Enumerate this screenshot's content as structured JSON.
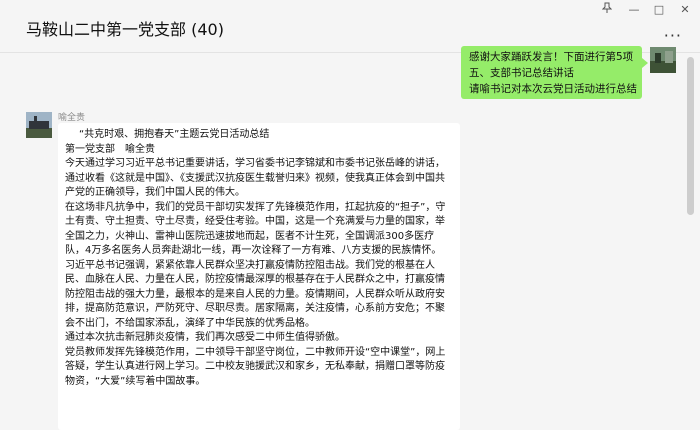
{
  "window": {
    "title": "马鞍山二中第一党支部 (40)",
    "pin_icon": "pin-icon",
    "minimize_label": "—",
    "maximize_label": "□",
    "close_label": "✕",
    "more_label": "···"
  },
  "messages": [
    {
      "side": "right",
      "lines": [
        "感谢大家踊跃发言！下面进行第5项",
        "五、支部书记总结讲话",
        "请喻书记对本次云党日活动进行总结"
      ]
    },
    {
      "side": "left",
      "sender": "喻全贵",
      "lines": [
        "“共克时艰、拥抱春天”主题云党日活动总结",
        "第一党支部　喻全贵",
        "今天通过学习习近平总书记重要讲话，学习省委书记李锦斌和市委书记张岳峰的讲话，通过收看《这就是中国》、《支援武汉抗疫医生载誉归来》视频，使我真正体会到中国共产党的正确领导，我们中国人民的伟大。",
        "在这场非凡抗争中，我们的党员干部切实发挥了先锋模范作用，扛起抗疫的“担子”，守土有责、守土担责、守土尽责，经受住考验。中国，这是一个充满爱与力量的国家，举全国之力，火神山、雷神山医院迅速拔地而起，医者不计生死，全国调派300多医疗队，4万多名医务人员奔赴湖北一线，再一次诠释了一方有难、八方支援的民族情怀。",
        "习近平总书记强调，紧紧依靠人民群众坚决打赢疫情防控阻击战。我们党的根基在人民、血脉在人民、力量在人民，防控疫情最深厚的根基存在于人民群众之中，打赢疫情防控阻击战的强大力量，最根本的是来自人民的力量。疫情期间，人民群众听从政府安排，提高防范意识，严防死守、尽职尽责。居家隔离，关注疫情，心系前方安危；不聚会不出门，不给国家添乱，演绎了中华民族的优秀品格。",
        "通过本次抗击新冠肺炎疫情，我们再次感受二中师生值得骄傲。",
        "党员教师发挥先锋模范作用，二中领导干部坚守岗位，二中教师开设“空中课堂”，网上答疑，学生认真进行网上学习。二中校友驰援武汉和家乡，无私奉献，捐赠口罩等防疫物资，“大爱”续写着中国故事。"
      ]
    }
  ]
}
